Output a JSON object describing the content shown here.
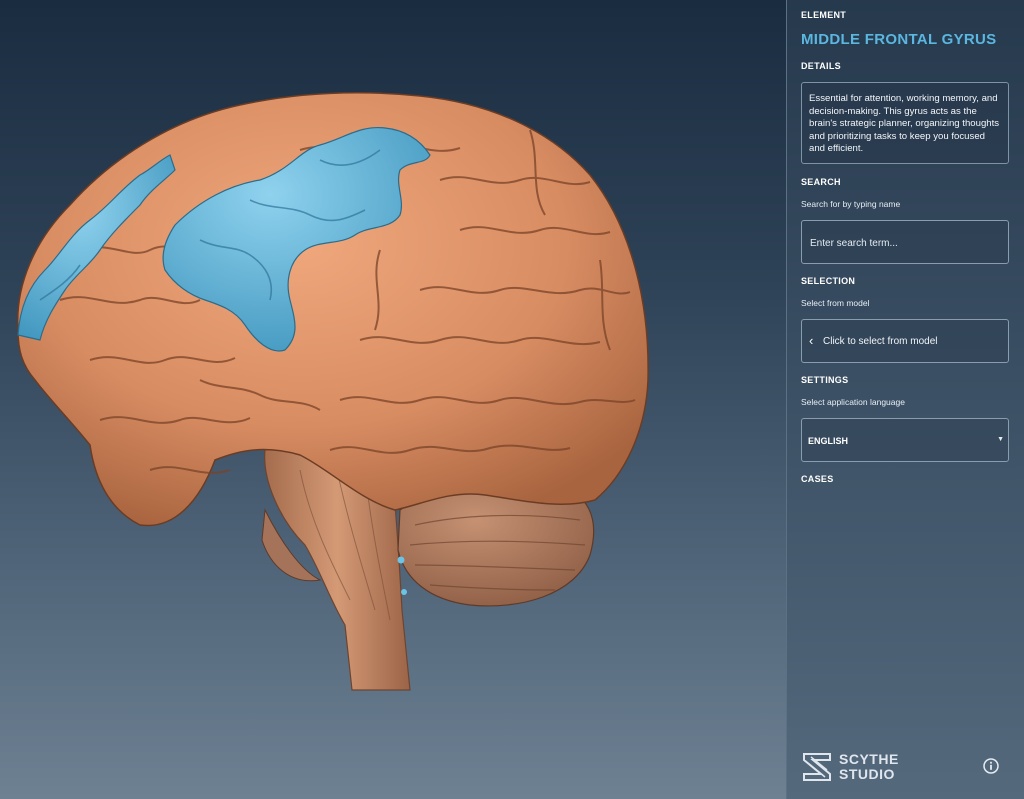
{
  "panel": {
    "element_heading": "ELEMENT",
    "element_name": "MIDDLE FRONTAL GYRUS",
    "details_heading": "DETAILS",
    "details_text": "Essential for attention, working memory, and decision-making. This gyrus acts as the brain's strategic planner, organizing thoughts and prioritizing tasks to keep you focused and efficient.",
    "search_heading": "SEARCH",
    "search_hint": "Search for by typing name",
    "search_placeholder": "Enter search term...",
    "selection_heading": "SELECTION",
    "selection_hint": "Select from model",
    "selection_button": "Click to select from model",
    "settings_heading": "SETTINGS",
    "settings_hint": "Select application language",
    "language_value": "ENGLISH",
    "cases_heading": "CASES"
  },
  "brand": {
    "line1": "SCYTHE",
    "line2": "STUDIO",
    "logo_icon": "scythe-studio-logo"
  },
  "icons": {
    "selection": "chevron-left-icon",
    "language": "dropdown-caret-icon",
    "info": "info-icon"
  },
  "colors": {
    "accent": "#5bb6e0",
    "brain": "#d88c62",
    "highlight": "#5db4d8",
    "brainstem": "#c98a66",
    "cerebellum": "#b07a5e"
  }
}
